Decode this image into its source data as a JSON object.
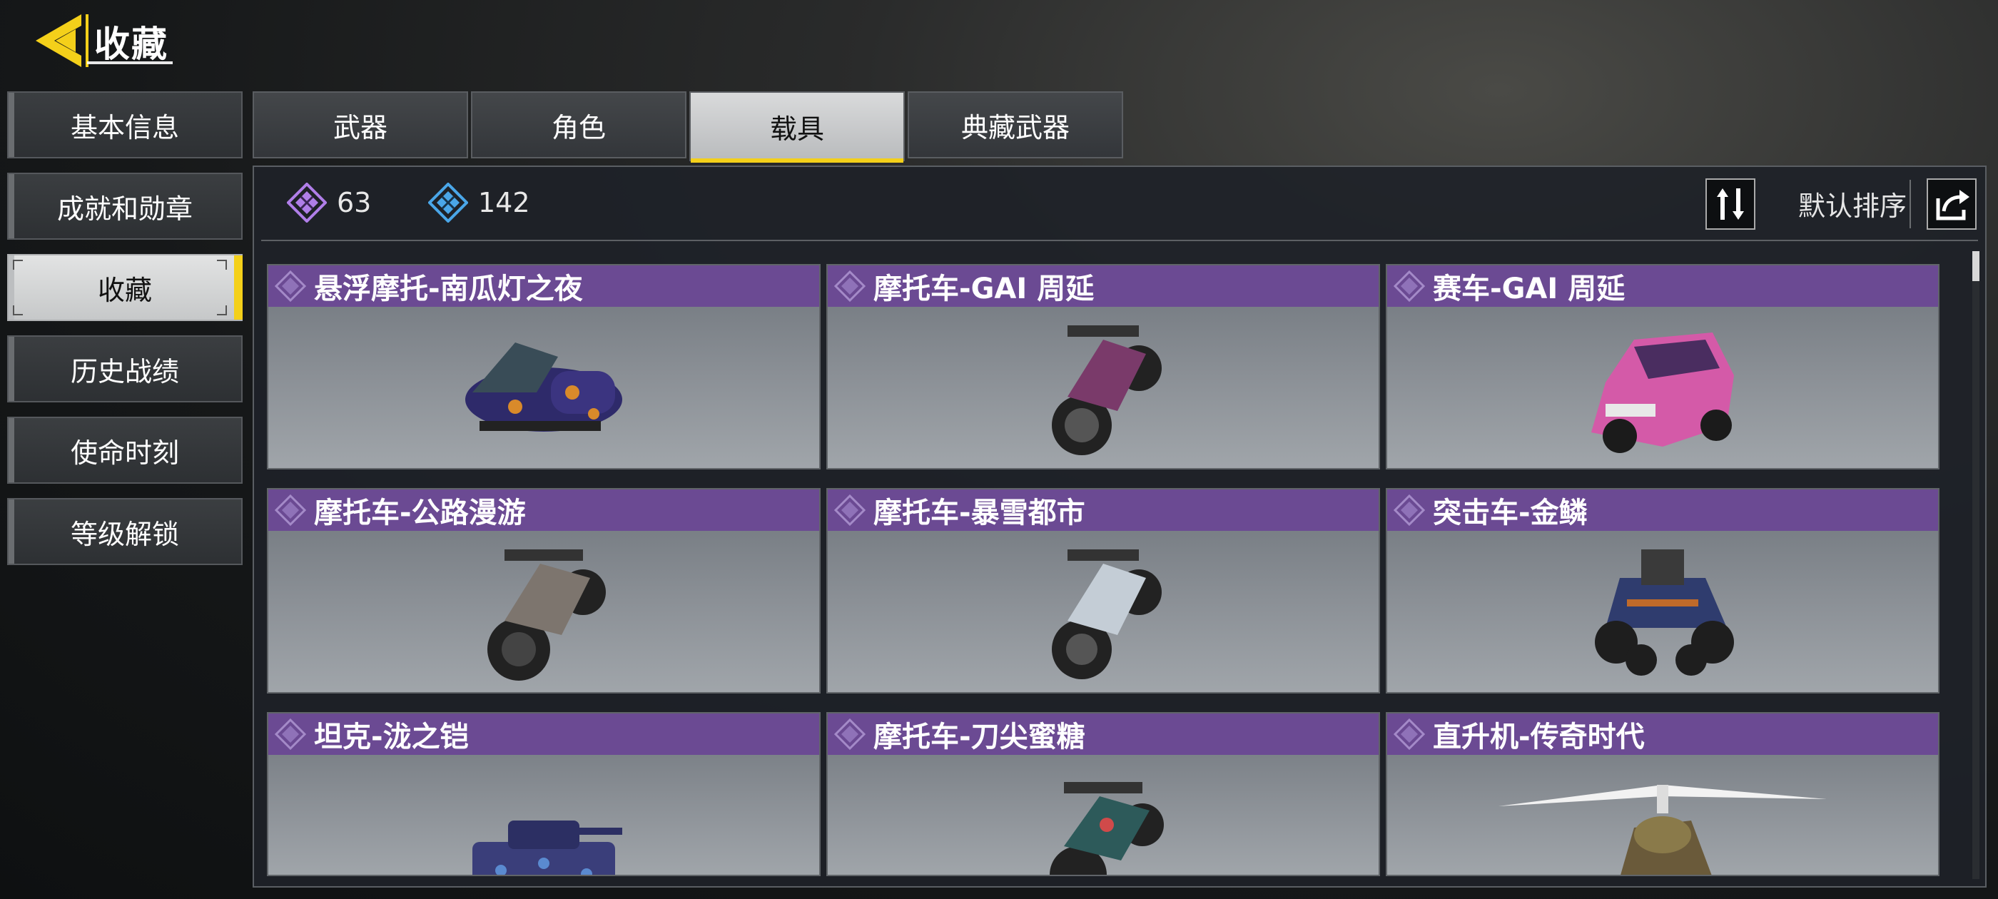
{
  "header": {
    "title": "收藏"
  },
  "sidebar": {
    "items": [
      {
        "label": "基本信息",
        "active": false
      },
      {
        "label": "成就和勋章",
        "active": false
      },
      {
        "label": "收藏",
        "active": true
      },
      {
        "label": "历史战绩",
        "active": false
      },
      {
        "label": "使命时刻",
        "active": false
      },
      {
        "label": "等级解锁",
        "active": false
      }
    ]
  },
  "tabs": [
    {
      "label": "武器",
      "active": false
    },
    {
      "label": "角色",
      "active": false
    },
    {
      "label": "载具",
      "active": true
    },
    {
      "label": "典藏武器",
      "active": false
    }
  ],
  "stats": {
    "purple_count": "63",
    "blue_count": "142"
  },
  "toolbar": {
    "sort_label": "默认排序",
    "sort_icon": "sort-swap-icon",
    "share_icon": "share-icon"
  },
  "colors": {
    "accent": "#f4d01a",
    "rarity_purple": "#6b4a93",
    "panel_bg": "#1e2228"
  },
  "vehicles": [
    {
      "name": "悬浮摩托-南瓜灯之夜",
      "kind": "hoverbike"
    },
    {
      "name": "摩托车-GAI 周延",
      "kind": "motorcycle"
    },
    {
      "name": "赛车-GAI 周延",
      "kind": "car"
    },
    {
      "name": "摩托车-公路漫游",
      "kind": "motorcycle"
    },
    {
      "name": "摩托车-暴雪都市",
      "kind": "motorcycle"
    },
    {
      "name": "突击车-金鳞",
      "kind": "buggy"
    },
    {
      "name": "坦克-泷之铠",
      "kind": "tank"
    },
    {
      "name": "摩托车-刀尖蜜糖",
      "kind": "motorcycle"
    },
    {
      "name": "直升机-传奇时代",
      "kind": "helicopter"
    }
  ]
}
